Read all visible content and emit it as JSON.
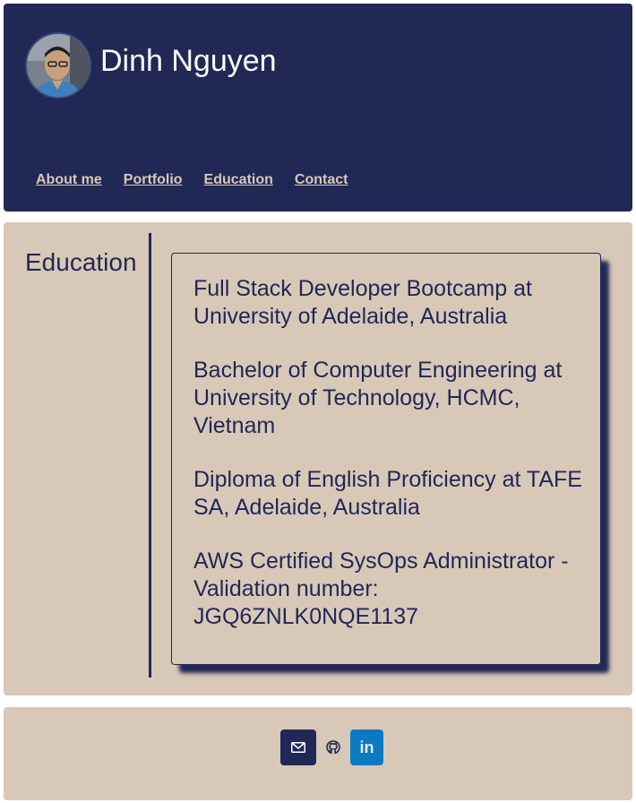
{
  "header": {
    "name": "Dinh Nguyen",
    "avatar_icon": "profile-photo",
    "nav": [
      {
        "label": "About me"
      },
      {
        "label": "Portfolio"
      },
      {
        "label": "Education"
      },
      {
        "label": "Contact"
      }
    ]
  },
  "education": {
    "title": "Education",
    "items": [
      "Full Stack Developer Bootcamp at University of Adelaide, Australia",
      "Bachelor of Computer Engineering at University of Technology, HCMC, Vietnam",
      "Diploma of English Proficiency at TAFE SA, Adelaide, Australia",
      "AWS Certified SysOps Administrator - Validation number: JGQ6ZNLK0NQE1137"
    ]
  },
  "footer": {
    "links": [
      {
        "icon": "email-icon"
      },
      {
        "icon": "github-icon"
      },
      {
        "icon": "linkedin-icon",
        "glyph": "in"
      }
    ]
  },
  "colors": {
    "primary": "#212855",
    "background": "#d8c8b8",
    "linkedin": "#0a7bc1"
  }
}
